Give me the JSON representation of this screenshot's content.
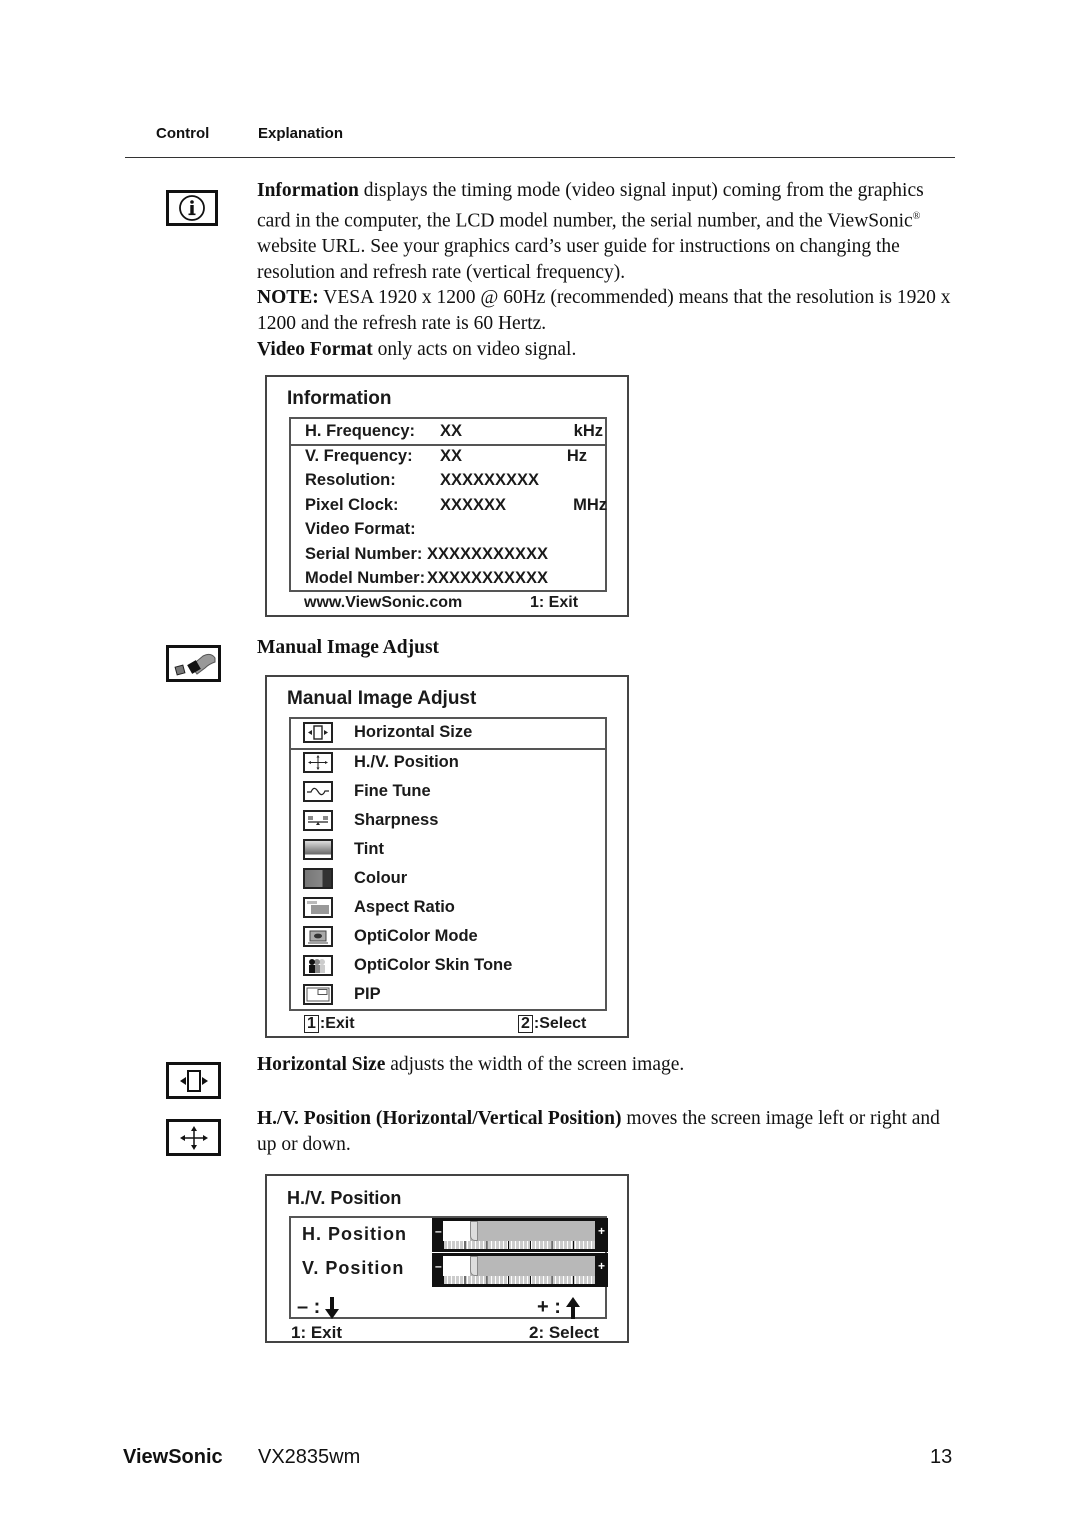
{
  "table_header": {
    "control": "Control",
    "explanation": "Explanation"
  },
  "information": {
    "icon": "info-icon",
    "title_bold": "Information",
    "text": " displays the timing mode (video signal input) coming from the graphics card in the computer, the LCD model number, the serial number, and the ViewSonic",
    "registered": "®",
    "text2": " website URL. See your graphics card’s user guide for instructions on changing the resolution and refresh rate (vertical frequency).",
    "note_bold": "NOTE:",
    "note_text": " VESA 1920 x 1200 @ 60Hz (recommended) means that the resolution is 1920 x 1200 and the refresh rate is 60 Hertz.",
    "vf_bold": "Video Format",
    "vf_text": " only acts on video signal."
  },
  "info_osd": {
    "title": "Information",
    "rows": [
      {
        "label": "H. Frequency:",
        "value": "XX",
        "unit": "kHz",
        "selected": true
      },
      {
        "label": "V. Frequency:",
        "value": "XX",
        "unit": "Hz"
      },
      {
        "label": "Resolution:",
        "value": "XXXXXXXXX",
        "unit": ""
      },
      {
        "label": "Pixel Clock:",
        "value": "XXXXXX",
        "unit": "MHz"
      },
      {
        "label": "Video Format:",
        "value": "",
        "unit": ""
      },
      {
        "label": "Serial Number:",
        "value": "XXXXXXXXXXX",
        "unit": ""
      },
      {
        "label": "Model Number:",
        "value": "XXXXXXXXXXX",
        "unit": ""
      }
    ],
    "url": "www.ViewSonic.com",
    "exit": "1: Exit"
  },
  "manual_image_adjust": {
    "icon": "wrench-icon",
    "heading": "Manual Image Adjust"
  },
  "mia_osd": {
    "title": "Manual Image Adjust",
    "items": [
      {
        "label": "Horizontal Size",
        "icon": "horizontal-size-icon",
        "selected": true
      },
      {
        "label": "H./V. Position",
        "icon": "hv-position-icon"
      },
      {
        "label": "Fine Tune",
        "icon": "fine-tune-icon"
      },
      {
        "label": "Sharpness",
        "icon": "sharpness-icon"
      },
      {
        "label": "Tint",
        "icon": "tint-icon"
      },
      {
        "label": "Colour",
        "icon": "colour-icon"
      },
      {
        "label": "Aspect Ratio",
        "icon": "aspect-ratio-icon"
      },
      {
        "label": "OptiColor Mode",
        "icon": "opticolor-mode-icon"
      },
      {
        "label": "OptiColor Skin Tone",
        "icon": "opticolor-skin-tone-icon"
      },
      {
        "label": "PIP",
        "icon": "pip-icon"
      }
    ],
    "exit_key": "1",
    "exit_label": ":Exit",
    "select_key": "2",
    "select_label": ":Select"
  },
  "horizontal_size": {
    "icon": "horizontal-size-icon",
    "bold": "Horizontal Size",
    "text": " adjusts the width of the screen image."
  },
  "hv_position": {
    "icon": "hv-position-icon",
    "bold": "H./V. Position (Horizontal/Vertical Position)",
    "text": " moves the screen image left or right and up or down."
  },
  "hv_osd": {
    "title": "H./V. Position",
    "sliders": [
      {
        "label": "H. Position",
        "value_fraction": 0.18
      },
      {
        "label": "V. Position",
        "value_fraction": 0.18
      }
    ],
    "minus_sign": "–",
    "plus_sign": "+",
    "minus_hint": "– :",
    "plus_hint": "+ :",
    "exit": "1: Exit",
    "select": "2: Select"
  },
  "footer": {
    "brand": "ViewSonic",
    "model": "VX2835wm",
    "page": "13"
  }
}
